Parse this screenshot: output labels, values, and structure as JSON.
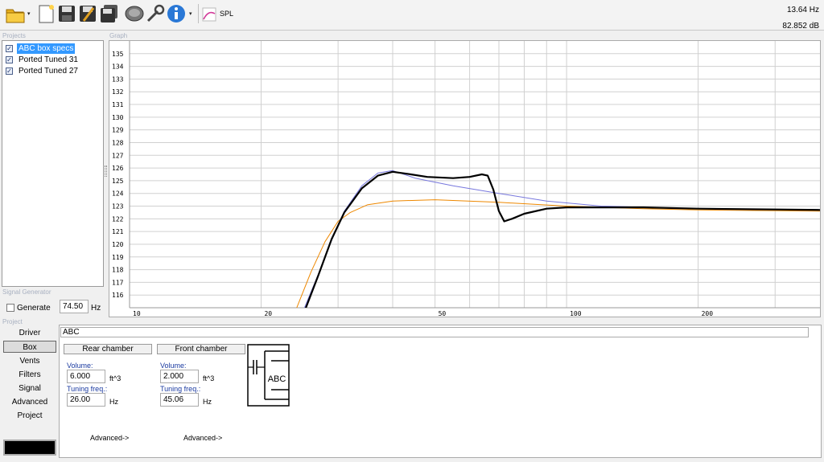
{
  "toolbar": {
    "icons": [
      "folder-open-icon",
      "new-file-icon",
      "save-icon",
      "save-as-icon",
      "save-all-icon",
      "driver-icon",
      "wrench-icon",
      "info-icon",
      "spl-graph-icon"
    ],
    "spl_label": "SPL",
    "readout_freq": "13.64 Hz",
    "readout_db": "82.852 dB"
  },
  "sections": {
    "projects": "Projects",
    "graph": "Graph",
    "signal_generator": "Signal Generator",
    "project": "Project"
  },
  "projects": [
    {
      "label": "ABC box specs",
      "checked": true,
      "selected": true
    },
    {
      "label": "Ported Tuned 31",
      "checked": true,
      "selected": false
    },
    {
      "label": "Ported Tuned 27",
      "checked": true,
      "selected": false
    }
  ],
  "signal_generator": {
    "generate_label": "Generate",
    "generate_checked": false,
    "frequency": "74.50",
    "unit": "Hz"
  },
  "nav": [
    {
      "label": "Driver",
      "active": false
    },
    {
      "label": "Box",
      "active": true
    },
    {
      "label": "Vents",
      "active": false
    },
    {
      "label": "Filters",
      "active": false
    },
    {
      "label": "Signal",
      "active": false
    },
    {
      "label": "Advanced",
      "active": false
    },
    {
      "label": "Project",
      "active": false
    }
  ],
  "project_panel": {
    "name": "ABC",
    "rear": {
      "title": "Rear chamber",
      "volume_label": "Volume:",
      "volume": "6.000",
      "volume_unit": "ft^3",
      "tuning_label": "Tuning freq.:",
      "tuning": "26.00",
      "tuning_unit": "Hz",
      "advanced": "Advanced->"
    },
    "front": {
      "title": "Front chamber",
      "volume_label": "Volume:",
      "volume": "2.000",
      "volume_unit": "ft^3",
      "tuning_label": "Tuning freq.:",
      "tuning": "45.06",
      "tuning_unit": "Hz",
      "advanced": "Advanced->"
    },
    "diagram_label": "ABC"
  },
  "chart_data": {
    "type": "line",
    "xscale": "log",
    "xlim": [
      10,
      380
    ],
    "ylim": [
      115,
      136
    ],
    "y_ticks": [
      116,
      117,
      118,
      119,
      120,
      121,
      122,
      123,
      124,
      125,
      126,
      127,
      128,
      129,
      130,
      131,
      132,
      133,
      134,
      135
    ],
    "x_tick_labels": [
      10,
      20,
      50,
      100,
      200
    ],
    "x_gridlines": [
      10,
      20,
      30,
      40,
      50,
      60,
      70,
      80,
      90,
      100,
      200,
      300
    ],
    "grid": true,
    "series": [
      {
        "color": "#000000",
        "width": 2.2,
        "points": [
          [
            25,
            114.5
          ],
          [
            27,
            117.5
          ],
          [
            29,
            120.4
          ],
          [
            31,
            122.5
          ],
          [
            34,
            124.4
          ],
          [
            37,
            125.4
          ],
          [
            40,
            125.7
          ],
          [
            44,
            125.5
          ],
          [
            48,
            125.3
          ],
          [
            55,
            125.2
          ],
          [
            60,
            125.3
          ],
          [
            64,
            125.5
          ],
          [
            66,
            125.4
          ],
          [
            68,
            124.3
          ],
          [
            70,
            122.6
          ],
          [
            72,
            121.8
          ],
          [
            75,
            122.0
          ],
          [
            80,
            122.4
          ],
          [
            90,
            122.8
          ],
          [
            100,
            122.9
          ],
          [
            150,
            122.9
          ],
          [
            200,
            122.8
          ],
          [
            380,
            122.7
          ]
        ]
      },
      {
        "color": "#7777dd",
        "width": 1,
        "points": [
          [
            25,
            114.8
          ],
          [
            27,
            117.6
          ],
          [
            29,
            120.3
          ],
          [
            31,
            122.6
          ],
          [
            34,
            124.6
          ],
          [
            37,
            125.6
          ],
          [
            40,
            125.8
          ],
          [
            45,
            125.2
          ],
          [
            55,
            124.6
          ],
          [
            70,
            124.0
          ],
          [
            90,
            123.4
          ],
          [
            120,
            123.0
          ],
          [
            200,
            122.8
          ],
          [
            380,
            122.7
          ]
        ]
      },
      {
        "color": "#ee8800",
        "width": 1,
        "points": [
          [
            24,
            114.8
          ],
          [
            26,
            117.8
          ],
          [
            28,
            120.2
          ],
          [
            30,
            121.8
          ],
          [
            32,
            122.5
          ],
          [
            35,
            123.1
          ],
          [
            40,
            123.4
          ],
          [
            50,
            123.5
          ],
          [
            70,
            123.3
          ],
          [
            100,
            123.0
          ],
          [
            150,
            122.8
          ],
          [
            200,
            122.7
          ],
          [
            380,
            122.6
          ]
        ]
      }
    ]
  }
}
